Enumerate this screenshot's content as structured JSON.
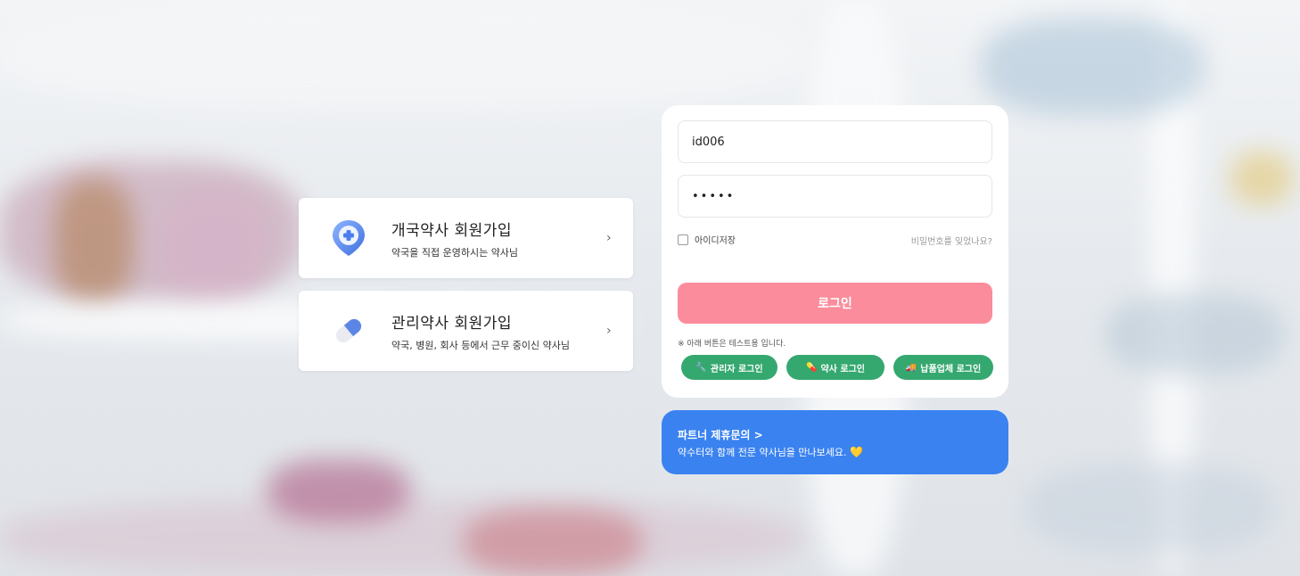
{
  "signup": [
    {
      "title": "개국약사 회원가입",
      "subtitle": "약국을 직접 운영하시는 약사님",
      "icon": "location-plus-icon",
      "chevron": "›"
    },
    {
      "title": "관리약사 회원가입",
      "subtitle": "약국, 병원, 회사 등에서 근무 중이신 약사님",
      "icon": "capsule-icon",
      "chevron": "›"
    }
  ],
  "login": {
    "id_value": "id006",
    "password_value": "•••••",
    "remember_label": "아이디저장",
    "forgot_label": "비밀번호를 잊었나요?",
    "login_label": "로그인",
    "test_note": "※ 아래 버튼은 테스트용 입니다.",
    "test_buttons": [
      {
        "label": "관리자 로그인",
        "icon": "wrench-icon",
        "glyph": "🔧"
      },
      {
        "label": "약사 로그인",
        "icon": "pill-icon",
        "glyph": "💊"
      },
      {
        "label": "납품업체 로그인",
        "icon": "truck-icon",
        "glyph": "🚚"
      }
    ]
  },
  "partner": {
    "title": "파트너 제휴문의 >",
    "subtitle": "약수터와 함께 전문 약사님을 만나보세요.",
    "emoji": "💛"
  },
  "colors": {
    "login_button": "#fb8c9b",
    "test_button": "#35a86f",
    "partner_banner": "#3a82f0"
  }
}
